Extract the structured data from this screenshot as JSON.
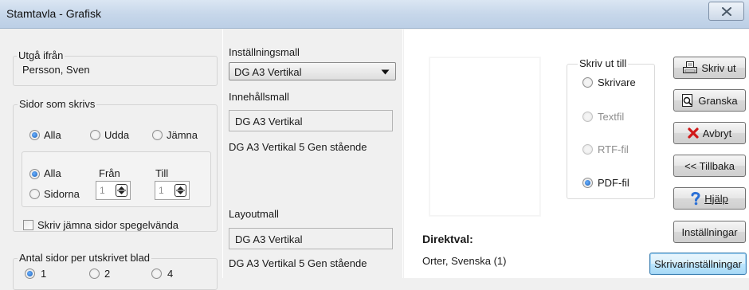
{
  "window": {
    "title": "Stamtavla - Grafisk"
  },
  "start_from": {
    "legend": "Utgå ifrån",
    "value": "Persson, Sven"
  },
  "pages_to_print": {
    "legend": "Sidor som skrivs",
    "parity_options": [
      "Alla",
      "Udda",
      "Jämna"
    ],
    "parity_selected": "Alla",
    "range_options": [
      "Alla",
      "Sidorna"
    ],
    "range_selected": "Alla",
    "from_label": "Från",
    "to_label": "Till",
    "from_value": "1",
    "to_value": "1",
    "mirror_even_label": "Skriv jämna sidor spegelvända",
    "mirror_even_checked": false
  },
  "pages_per_sheet": {
    "legend": "Antal sidor per utskrivet blad",
    "options": [
      "1",
      "2",
      "4"
    ],
    "selected": "1"
  },
  "settings_template": {
    "label": "Inställningsmall",
    "value": "DG A3 Vertikal"
  },
  "content_template": {
    "label": "Innehållsmall",
    "value": "DG A3 Vertikal",
    "description": "DG A3 Vertikal 5 Gen stående"
  },
  "layout_template": {
    "label": "Layoutmall",
    "value": "DG A3 Vertikal",
    "description": "DG A3 Vertikal 5 Gen stående"
  },
  "output": {
    "legend": "Skriv ut till",
    "options": [
      "Skrivare",
      "Textfil",
      "RTF-fil",
      "PDF-fil"
    ],
    "selected": "PDF-fil"
  },
  "direct_selection": {
    "label": "Direktval:",
    "value": "Orter, Svenska (1)"
  },
  "buttons": {
    "print": "Skriv ut",
    "preview": "Granska",
    "cancel": "Avbryt",
    "back": "<< Tillbaka",
    "help": "Hjälp",
    "settings": "Inställningar",
    "printer_settings": "Skrivarinställningar"
  },
  "colors": {
    "titlebar": "#c7d7ea",
    "accent_radio": "#1a5fb4",
    "cancel_icon": "#d01818",
    "help_icon": "#2a6fd6"
  }
}
